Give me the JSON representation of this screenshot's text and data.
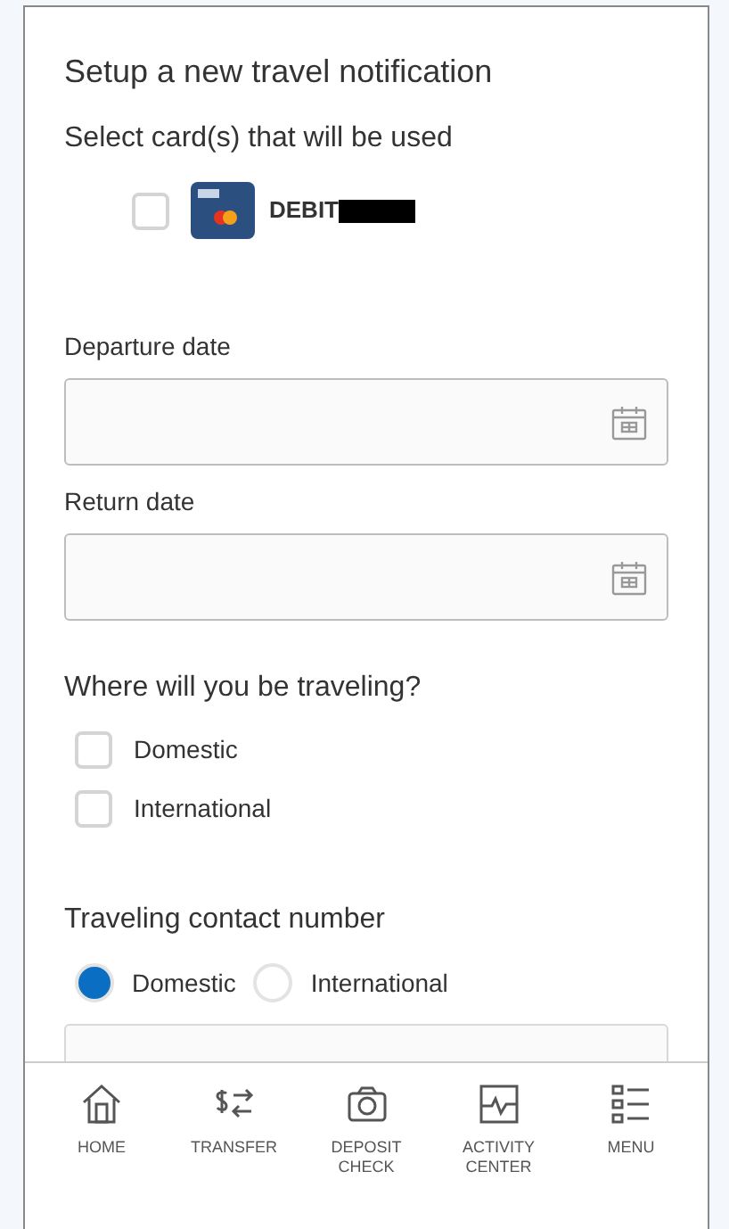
{
  "title": "Setup a new travel notification",
  "cards_label": "Select card(s) that will be used",
  "cards": [
    {
      "name": "DEBIT",
      "checked": false,
      "redacted": true
    }
  ],
  "date_fields": [
    {
      "label": "Departure date"
    },
    {
      "label": "Return date"
    }
  ],
  "destination": {
    "label": "Where will you be traveling?",
    "options": [
      {
        "label": "Domestic",
        "checked": false
      },
      {
        "label": "International",
        "checked": false
      }
    ]
  },
  "contact": {
    "label": "Traveling contact number",
    "options": [
      {
        "label": "Domestic",
        "selected": true
      },
      {
        "label": "International",
        "selected": false
      }
    ]
  },
  "nav": [
    {
      "kind": "home",
      "label": "HOME"
    },
    {
      "kind": "transfer",
      "label": "TRANSFER"
    },
    {
      "kind": "camera",
      "label": "DEPOSIT CHECK"
    },
    {
      "kind": "activity",
      "label": "ACTIVITY CENTER"
    },
    {
      "kind": "menu",
      "label": "MENU"
    }
  ]
}
